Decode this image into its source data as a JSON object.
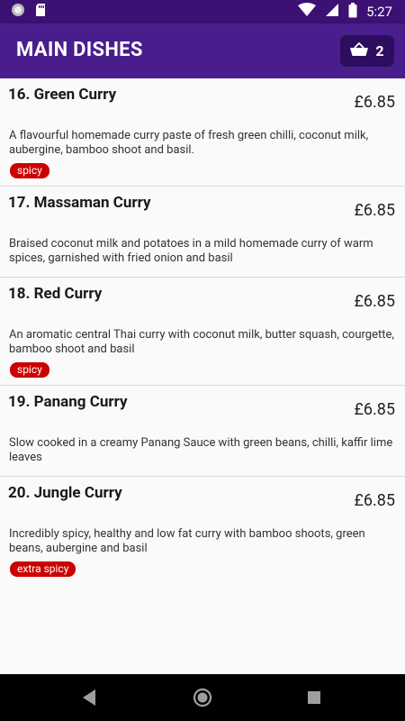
{
  "status_bar": {
    "time": "5:27",
    "icons": [
      "notification-circle-icon",
      "sd-card-icon",
      "wifi-icon",
      "cellular-icon",
      "battery-icon"
    ]
  },
  "app_bar": {
    "title": "MAIN DISHES",
    "cart_icon": "basket-icon",
    "cart_count": "2"
  },
  "items": [
    {
      "name": "16. Green Curry",
      "price": "£6.85",
      "description": "A flavourful homemade curry paste of fresh green chilli, coconut milk, aubergine, bamboo shoot and basil.",
      "badge": "spicy"
    },
    {
      "name": "17. Massaman Curry",
      "price": "£6.85",
      "description": "Braised coconut milk and potatoes in a mild homemade curry of warm spices, garnished with fried onion and basil",
      "badge": ""
    },
    {
      "name": "18. Red Curry",
      "price": "£6.85",
      "description": "An aromatic central Thai curry with coconut milk, butter squash, courgette, bamboo shoot and basil",
      "badge": "spicy"
    },
    {
      "name": "19. Panang Curry",
      "price": "£6.85",
      "description": "Slow cooked in a creamy Panang Sauce with green beans, chilli, kaffir lime leaves",
      "badge": ""
    },
    {
      "name": "20. Jungle Curry",
      "price": "£6.85",
      "description": "Incredibly spicy, healthy and low fat curry with bamboo shoots, green beans, aubergine and basil",
      "badge": "extra spicy"
    }
  ],
  "nav_bar": {
    "icons": [
      "back-icon",
      "home-icon",
      "recents-icon"
    ]
  },
  "colors": {
    "status_bar": "#3b1173",
    "app_bar": "#4a1d8c",
    "cart_button": "#2d0d5e",
    "badge": "#cc0000"
  }
}
